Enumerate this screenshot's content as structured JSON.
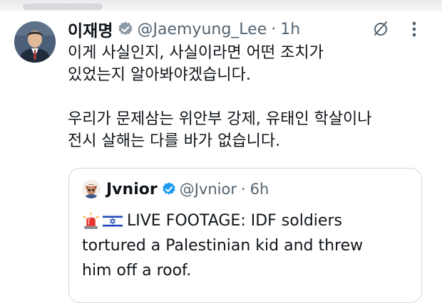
{
  "author": {
    "display_name": "이재명",
    "handle": "@Jaemyung_Lee",
    "separator": "·",
    "time": "1h"
  },
  "tweet": {
    "lines": [
      "이게 사실인지, 사실이라면 어떤 조치가",
      "있었는지 알아봐야겠습니다.",
      "",
      "우리가 문제삼는 위안부 강제, 유태인 학살이나",
      "전시 살해는 다를 바가 없습니다."
    ]
  },
  "quoted": {
    "display_name": "Jvnior",
    "handle": "@Jvnior",
    "separator": "·",
    "time": "6h",
    "line1": "LIVE FOOTAGE: IDF soldiers",
    "line2": "tortured a Palestinian kid and threw",
    "line3": "him off a roof."
  },
  "icons": {
    "verified": "verified-badge-icon",
    "mute": "mute-icon",
    "more": "more-vertical-icon",
    "siren": "rotating-light-emoji",
    "flag": "israel-flag-emoji"
  },
  "colors": {
    "verified": "#1d9bf0",
    "text": "#0f1419",
    "secondary": "#536471",
    "border": "#cfd9de"
  }
}
